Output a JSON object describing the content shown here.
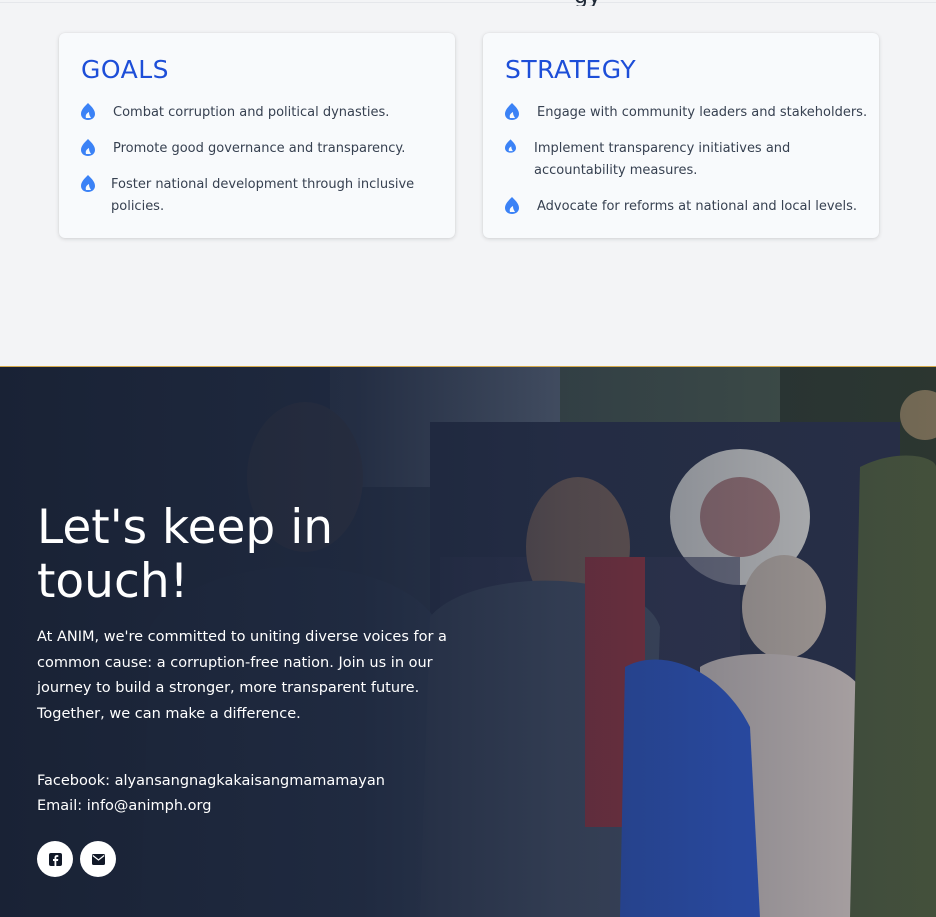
{
  "goals": {
    "title": "GOALS",
    "items": [
      "Combat corruption and political dynasties.",
      "Promote good governance and transparency.",
      "Foster national development through inclusive policies."
    ]
  },
  "strategy": {
    "title": "STRATEGY",
    "items": [
      "Engage with community leaders and stakeholders.",
      "Implement transparency initiatives and accountability measures.",
      "Advocate for reforms at national and local levels."
    ]
  },
  "footer": {
    "title": "Let's keep in touch!",
    "body": "At ANIM, we're committed to uniting diverse voices for a common cause: a corruption-free nation. Join us in our journey to build a stronger, more transparent future. Together, we can make a difference.",
    "facebook": "Facebook: alyansangnagkakaisangmamamayan",
    "email": "Email: info@animph.org"
  },
  "icons": {
    "bullet": "flame-icon",
    "social": [
      "facebook-icon",
      "mail-icon"
    ]
  },
  "colors": {
    "accent": "#1d4ed8",
    "bullet": "#3b82f6",
    "footer_overlay": "#1e2940"
  }
}
